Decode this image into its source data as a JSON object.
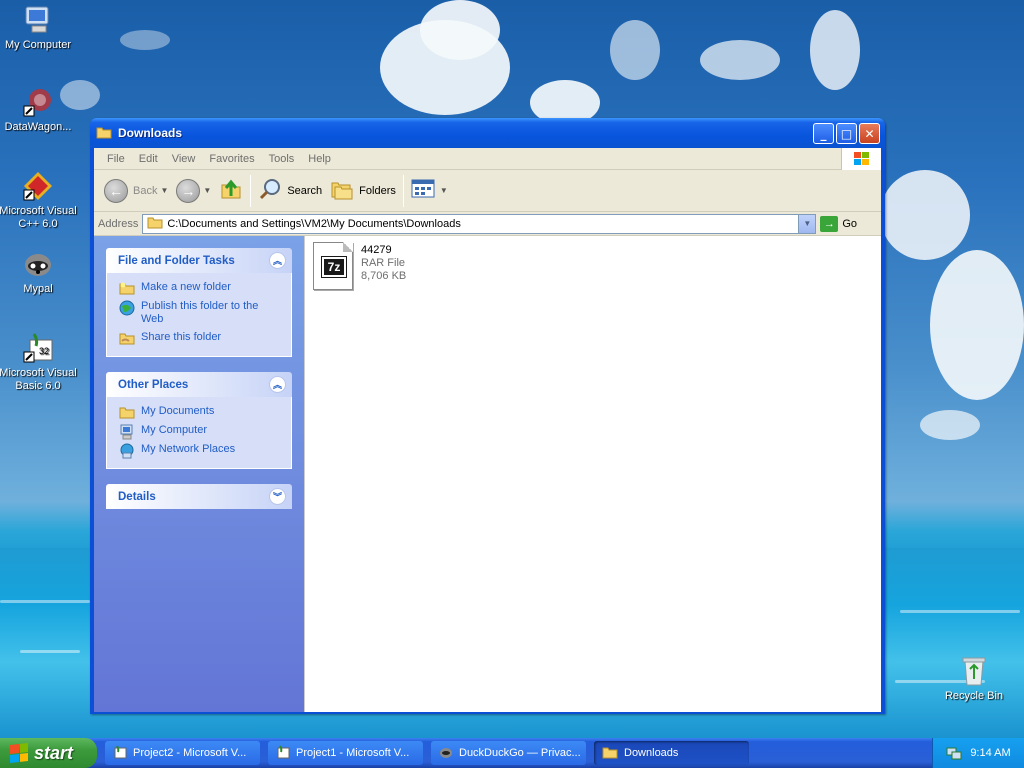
{
  "desktop": {
    "icons": [
      {
        "label": "My Computer"
      },
      {
        "label": "DataWagon..."
      },
      {
        "label": "Microsoft Visual C++ 6.0"
      },
      {
        "label": "Mypal"
      },
      {
        "label": "Microsoft Visual Basic 6.0"
      },
      {
        "label": "Recycle Bin"
      }
    ]
  },
  "window": {
    "title": "Downloads",
    "menu": [
      "File",
      "Edit",
      "View",
      "Favorites",
      "Tools",
      "Help"
    ],
    "toolbar": {
      "back_label": "Back",
      "search_label": "Search",
      "folders_label": "Folders"
    },
    "address": {
      "label": "Address",
      "value": "C:\\Documents and Settings\\VM2\\My Documents\\Downloads",
      "go_label": "Go"
    },
    "taskpane": {
      "file_tasks": {
        "title": "File and Folder Tasks",
        "items": [
          "Make a new folder",
          "Publish this folder to the Web",
          "Share this folder"
        ]
      },
      "other_places": {
        "title": "Other Places",
        "items": [
          "My Documents",
          "My Computer",
          "My Network Places"
        ]
      },
      "details": {
        "title": "Details"
      }
    },
    "files": [
      {
        "name": "44279",
        "type": "RAR File",
        "size": "8,706 KB",
        "badge": "7z"
      }
    ]
  },
  "taskbar": {
    "start_label": "start",
    "buttons": [
      {
        "label": "Project2 - Microsoft V..."
      },
      {
        "label": "Project1 - Microsoft V..."
      },
      {
        "label": "DuckDuckGo — Privac..."
      },
      {
        "label": "Downloads"
      }
    ],
    "clock": "9:14 AM"
  },
  "colors": {
    "title_blue": "#0a4fd6",
    "link_blue": "#215dc6",
    "start_green": "#3c9a3c"
  }
}
